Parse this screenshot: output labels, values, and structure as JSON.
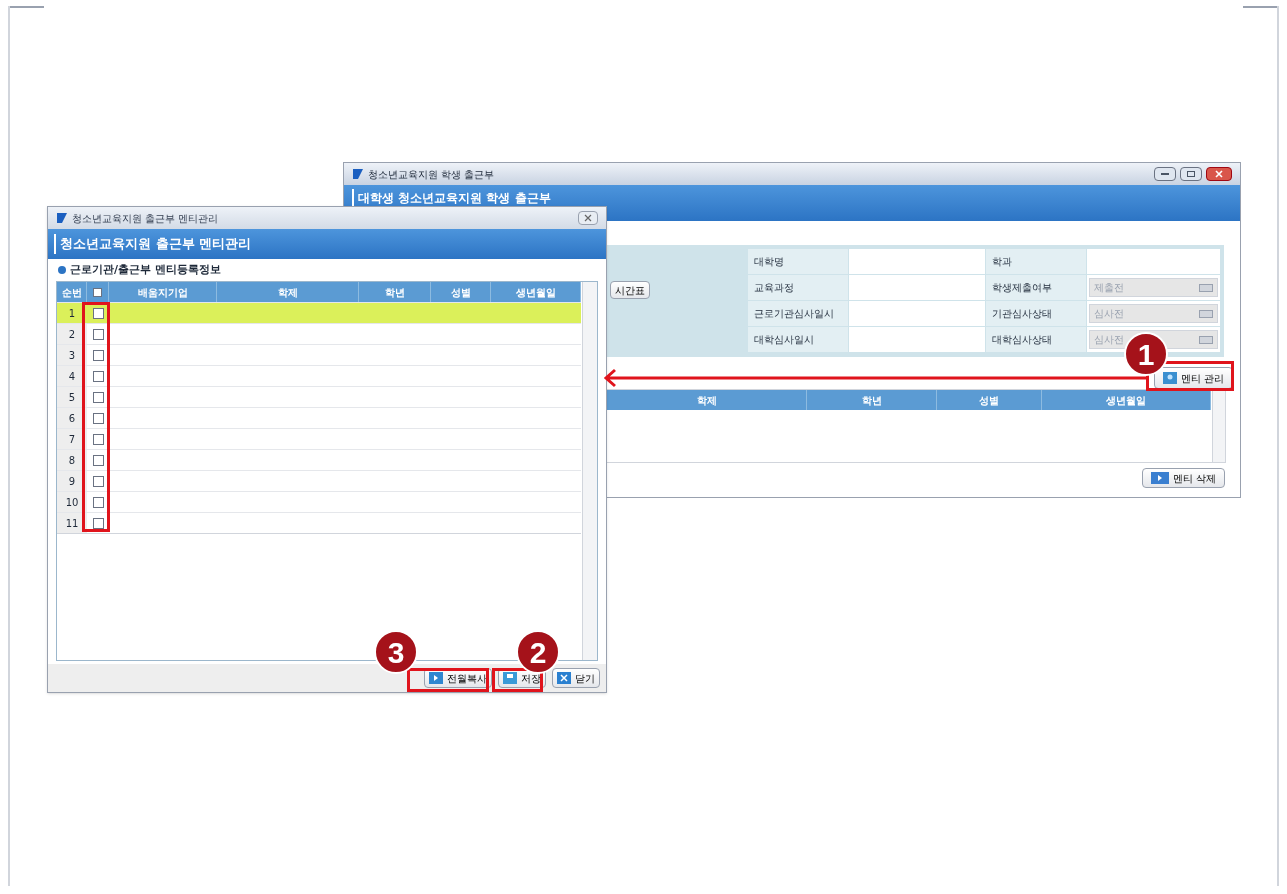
{
  "back_window": {
    "title": "청소년교육지원 학생 출근부",
    "header": "대학생 청소년교육지원 학생 출근부",
    "schedule_button": "시간표",
    "form_rows": [
      [
        {
          "label": "대학명",
          "kind": "text"
        },
        {
          "label": "학과",
          "kind": "text"
        }
      ],
      [
        {
          "label": "교육과정",
          "kind": "text"
        },
        {
          "label": "학생제출여부",
          "kind": "select",
          "value": "제출전",
          "disabled": true
        }
      ],
      [
        {
          "label": "근로기관심사일시",
          "kind": "text"
        },
        {
          "label": "기관심사상태",
          "kind": "select",
          "value": "심사전",
          "disabled": true
        }
      ],
      [
        {
          "label": "대학심사일시",
          "kind": "text"
        },
        {
          "label": "대학심사상태",
          "kind": "select",
          "value": "심사전",
          "disabled": true
        }
      ]
    ],
    "manage_button": "멘티 관리",
    "grid_columns": [
      "학제",
      "학년",
      "성별",
      "생년월일"
    ],
    "delete_button": "멘티 삭제"
  },
  "front_window": {
    "title": "청소년교육지원 출근부 멘티관리",
    "header": "청소년교육지원 출근부 멘티관리",
    "section_title": "근로기관/출근부 멘티등록정보",
    "columns": [
      {
        "kind": "text",
        "label": "순번"
      },
      {
        "kind": "checkbox",
        "checked": false
      },
      {
        "kind": "text",
        "label": "배움지기업"
      },
      {
        "kind": "text",
        "label": "학제"
      },
      {
        "kind": "text",
        "label": "학년"
      },
      {
        "kind": "text",
        "label": "성별"
      },
      {
        "kind": "text",
        "label": "생년월일"
      }
    ],
    "rows": [
      {
        "number": "1",
        "checked": false,
        "selected": true
      },
      {
        "number": "2",
        "checked": false,
        "selected": false
      },
      {
        "number": "3",
        "checked": false,
        "selected": false
      },
      {
        "number": "4",
        "checked": false,
        "selected": false
      },
      {
        "number": "5",
        "checked": false,
        "selected": false
      },
      {
        "number": "6",
        "checked": false,
        "selected": false
      },
      {
        "number": "7",
        "checked": false,
        "selected": false
      },
      {
        "number": "8",
        "checked": false,
        "selected": false
      },
      {
        "number": "9",
        "checked": false,
        "selected": false
      },
      {
        "number": "10",
        "checked": false,
        "selected": false
      },
      {
        "number": "11",
        "checked": false,
        "selected": false
      }
    ],
    "buttons": [
      {
        "label": "전월복사",
        "kind": "copy"
      },
      {
        "label": "저장",
        "kind": "save"
      },
      {
        "label": "닫기",
        "kind": "close"
      }
    ]
  },
  "annotations": [
    {
      "number": "1"
    },
    {
      "number": "2"
    },
    {
      "number": "3"
    }
  ]
}
